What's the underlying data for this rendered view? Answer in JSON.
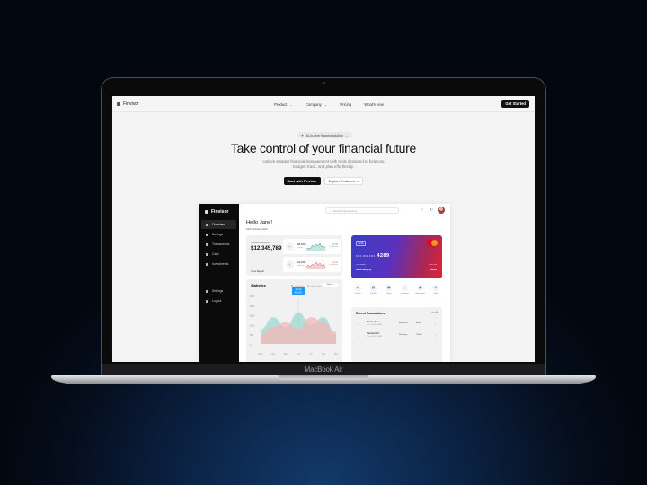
{
  "device": {
    "label": "MacBook Air"
  },
  "site": {
    "brand": "Finvisor",
    "nav": [
      {
        "label": "Product",
        "has_dropdown": true
      },
      {
        "label": "Company",
        "has_dropdown": true
      },
      {
        "label": "Pricing",
        "has_dropdown": false
      },
      {
        "label": "What's new",
        "has_dropdown": false
      }
    ],
    "cta": "Get Started",
    "hero": {
      "pill": "All-in-One finance solution",
      "pill_arrow": "→",
      "title": "Take control of your financial future",
      "subtitle": "Unlock smarter financial management with tools designed to help you budget, track, and plan effortlessly.",
      "primary_button": "Start with Finvisor",
      "secondary_button": "Explore Features",
      "secondary_arrow": "→"
    }
  },
  "dashboard": {
    "brand": "Finvisor",
    "sidebar": {
      "items": [
        {
          "label": "Overview",
          "icon": "grid-icon",
          "active": true
        },
        {
          "label": "Savings",
          "icon": "piggy-icon",
          "active": false
        },
        {
          "label": "Transactions",
          "icon": "swap-icon",
          "active": false
        },
        {
          "label": "Card",
          "icon": "card-icon",
          "active": false
        },
        {
          "label": "Investments",
          "icon": "trend-icon",
          "active": false
        }
      ],
      "bottom": [
        {
          "label": "Settings",
          "icon": "gear-icon"
        },
        {
          "label": "Logout",
          "icon": "logout-icon"
        }
      ]
    },
    "search_placeholder": "Search transactions...",
    "greeting": "Hello Jane!",
    "date": "24th October, 2024",
    "balance": {
      "label": "Available Balance",
      "value": "$12,345,789",
      "link": "View Report",
      "income": {
        "amount": "$55,000",
        "label": "Income",
        "pct": "+8.4%",
        "sub": "Last Month",
        "color": "#2a9d8f"
      },
      "outflow": {
        "amount": "$23,000",
        "label": "Outflow",
        "pct": "+2.1%",
        "sub": "Last Month",
        "color": "#e05a5a"
      }
    },
    "statistics": {
      "title": "Statistics",
      "legend": [
        {
          "label": "Total Inflow",
          "color": "#7fcfc3"
        },
        {
          "label": "Total Outflow",
          "color": "#f2a5a5"
        }
      ],
      "period": "Week",
      "tooltip": [
        "Actual",
        "$20,000"
      ]
    },
    "card": {
      "type": "Debit",
      "masked": "•••• •••• ••••",
      "last4": "4289",
      "holder_label": "Card Holder",
      "holder": "Jane Murphy",
      "valid_label": "Valid Thru",
      "valid": "09/28"
    },
    "actions": [
      {
        "label": "Transfer",
        "icon": "send-icon"
      },
      {
        "label": "Pay Bills",
        "icon": "bill-icon"
      },
      {
        "label": "Top up",
        "icon": "topup-icon"
      },
      {
        "label": "Investment",
        "icon": "invest-icon"
      },
      {
        "label": "Subscriptions",
        "icon": "sub-icon"
      },
      {
        "label": "More",
        "icon": "more-icon"
      }
    ],
    "transactions": {
      "title": "Recent Transactions",
      "see_all": "See All",
      "rows": [
        {
          "name": "Peace Jean",
          "date": "24 Oct 2024, 9:20AM",
          "category": "Allowance",
          "amount": "$2000",
          "dir": "↑"
        },
        {
          "name": "Samantha P.",
          "date": "24 Oct 2024, 8:10AM",
          "category": "Shopping",
          "amount": "-$5000",
          "dir": "↓"
        }
      ]
    }
  },
  "chart_data": {
    "type": "area",
    "title": "Statistics",
    "categories": [
      "Mon",
      "Tue",
      "Wed",
      "Thu",
      "Fri",
      "Sat",
      "Sun"
    ],
    "yticks": [
      "$40k",
      "$30k",
      "$20k",
      "$10k",
      "$5k",
      "0"
    ],
    "ylim": [
      0,
      40
    ],
    "series": [
      {
        "name": "Total Inflow",
        "values": [
          12,
          22,
          14,
          26,
          16,
          22,
          8
        ]
      },
      {
        "name": "Total Outflow",
        "values": [
          8,
          14,
          18,
          12,
          22,
          18,
          10
        ]
      }
    ],
    "legend": "top-right"
  }
}
